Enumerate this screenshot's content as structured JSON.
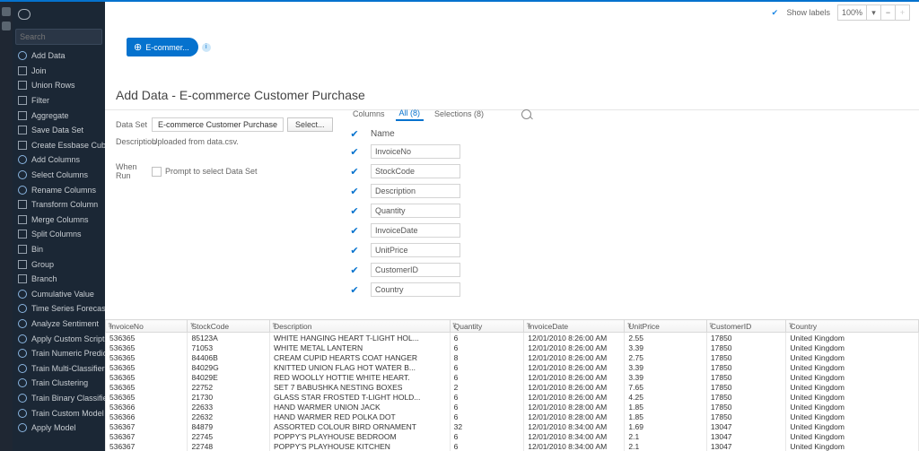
{
  "topbar": {
    "show_labels": "Show labels",
    "zoom": "100%"
  },
  "sidebar": {
    "search_placeholder": "Search",
    "items": [
      "Add Data",
      "Join",
      "Union Rows",
      "Filter",
      "Aggregate",
      "Save Data Set",
      "Create Essbase Cube",
      "Add Columns",
      "Select Columns",
      "Rename Columns",
      "Transform Column",
      "Merge Columns",
      "Split Columns",
      "Bin",
      "Group",
      "Branch",
      "Cumulative Value",
      "Time Series Forecast",
      "Analyze Sentiment",
      "Apply Custom Script",
      "Train Numeric Prediction",
      "Train Multi-Classifier",
      "Train Clustering",
      "Train Binary Classifier",
      "Train Custom Model",
      "Apply Model"
    ]
  },
  "pill": {
    "label": "E-commer..."
  },
  "page_title": "Add Data - E-commerce Customer Purchase",
  "form": {
    "dataset_label": "Data Set",
    "dataset_value": "E-commerce Customer Purchase",
    "select_btn": "Select...",
    "description_label": "Description",
    "description_value": "Uploaded from data.csv.",
    "whenrun_label": "When Run",
    "prompt_label": "Prompt to select Data Set"
  },
  "col_tabs": {
    "columns": "Columns",
    "all": "All (8)",
    "selections": "Selections (8)"
  },
  "columns": [
    "Name",
    "InvoiceNo",
    "StockCode",
    "Description",
    "Quantity",
    "InvoiceDate",
    "UnitPrice",
    "CustomerID",
    "Country"
  ],
  "grid": {
    "headers": [
      "InvoiceNo",
      "StockCode",
      "Description",
      "Quantity",
      "InvoiceDate",
      "UnitPrice",
      "CustomerID",
      "Country"
    ],
    "rows": [
      [
        "536365",
        "85123A",
        "WHITE HANGING HEART T-LIGHT HOL...",
        "6",
        "12/01/2010 8:26:00 AM",
        "2.55",
        "17850",
        "United Kingdom"
      ],
      [
        "536365",
        "71053",
        "WHITE METAL LANTERN",
        "6",
        "12/01/2010 8:26:00 AM",
        "3.39",
        "17850",
        "United Kingdom"
      ],
      [
        "536365",
        "84406B",
        "CREAM CUPID HEARTS COAT HANGER",
        "8",
        "12/01/2010 8:26:00 AM",
        "2.75",
        "17850",
        "United Kingdom"
      ],
      [
        "536365",
        "84029G",
        "KNITTED UNION FLAG HOT WATER B...",
        "6",
        "12/01/2010 8:26:00 AM",
        "3.39",
        "17850",
        "United Kingdom"
      ],
      [
        "536365",
        "84029E",
        "RED WOOLLY HOTTIE WHITE HEART.",
        "6",
        "12/01/2010 8:26:00 AM",
        "3.39",
        "17850",
        "United Kingdom"
      ],
      [
        "536365",
        "22752",
        "SET 7 BABUSHKA NESTING BOXES",
        "2",
        "12/01/2010 8:26:00 AM",
        "7.65",
        "17850",
        "United Kingdom"
      ],
      [
        "536365",
        "21730",
        "GLASS STAR FROSTED T-LIGHT HOLD...",
        "6",
        "12/01/2010 8:26:00 AM",
        "4.25",
        "17850",
        "United Kingdom"
      ],
      [
        "536366",
        "22633",
        "HAND WARMER UNION JACK",
        "6",
        "12/01/2010 8:28:00 AM",
        "1.85",
        "17850",
        "United Kingdom"
      ],
      [
        "536366",
        "22632",
        "HAND WARMER RED POLKA DOT",
        "6",
        "12/01/2010 8:28:00 AM",
        "1.85",
        "17850",
        "United Kingdom"
      ],
      [
        "536367",
        "84879",
        "ASSORTED COLOUR BIRD ORNAMENT",
        "32",
        "12/01/2010 8:34:00 AM",
        "1.69",
        "13047",
        "United Kingdom"
      ],
      [
        "536367",
        "22745",
        "POPPY'S PLAYHOUSE BEDROOM",
        "6",
        "12/01/2010 8:34:00 AM",
        "2.1",
        "13047",
        "United Kingdom"
      ],
      [
        "536367",
        "22748",
        "POPPY'S PLAYHOUSE KITCHEN",
        "6",
        "12/01/2010 8:34:00 AM",
        "2.1",
        "13047",
        "United Kingdom"
      ]
    ]
  }
}
